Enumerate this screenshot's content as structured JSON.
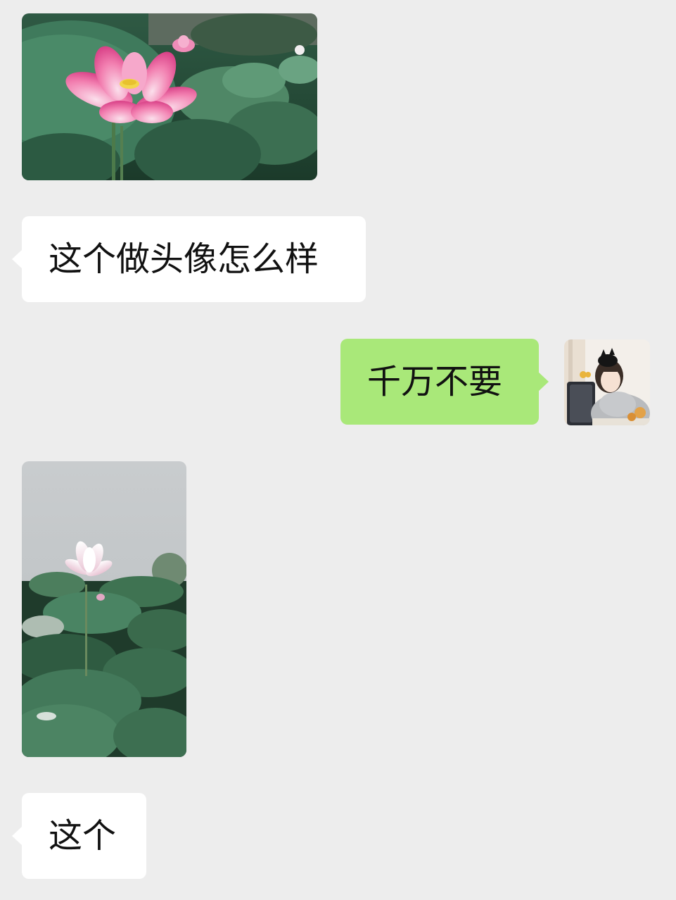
{
  "messages": [
    {
      "type": "image",
      "side": "left",
      "image": "pink-lotus-photo"
    },
    {
      "type": "text",
      "side": "left",
      "text": "这个做头像怎么样"
    },
    {
      "type": "text",
      "side": "right",
      "text": "千万不要",
      "avatar": "girl-with-cat-avatar"
    },
    {
      "type": "image",
      "side": "left",
      "image": "white-lotus-photo"
    },
    {
      "type": "text",
      "side": "left",
      "text": "这个"
    }
  ],
  "colors": {
    "background": "#ededed",
    "incoming_bubble": "#ffffff",
    "outgoing_bubble": "#a9e879",
    "text": "#111111"
  }
}
